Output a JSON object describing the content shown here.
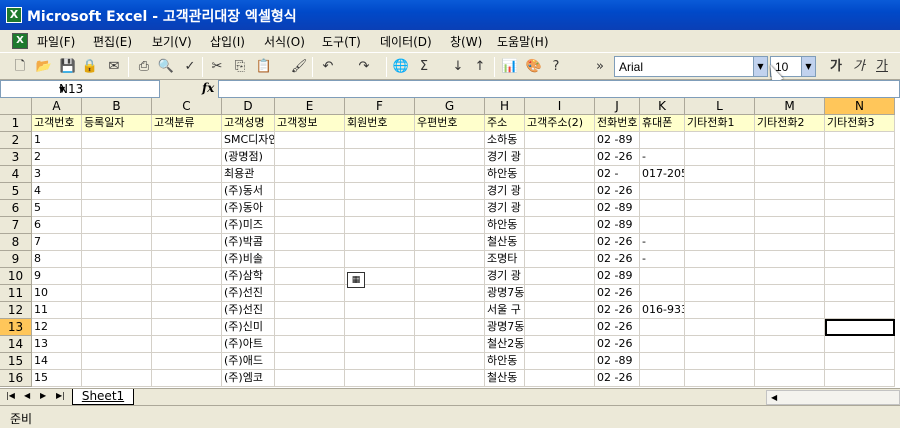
{
  "window": {
    "title": "Microsoft Excel - 고객관리대장 엑셀형식",
    "app_icon": "X"
  },
  "menu": [
    {
      "id": "file",
      "label": "파일(F)"
    },
    {
      "id": "edit",
      "label": "편집(E)"
    },
    {
      "id": "view",
      "label": "보기(V)"
    },
    {
      "id": "insert",
      "label": "삽입(I)"
    },
    {
      "id": "format",
      "label": "서식(O)"
    },
    {
      "id": "tools",
      "label": "도구(T)"
    },
    {
      "id": "data",
      "label": "데이터(D)"
    },
    {
      "id": "window",
      "label": "창(W)"
    },
    {
      "id": "help",
      "label": "도움말(H)"
    }
  ],
  "toolbar": {
    "font_name": "Arial",
    "font_size": "10",
    "bold_label": "가",
    "italic_label": "가",
    "underline_label": "가",
    "sigma": "Σ",
    "more": "»"
  },
  "formula_bar": {
    "name_box": "N13",
    "fx_label": "fx",
    "formula": ""
  },
  "columns": [
    "A",
    "B",
    "C",
    "D",
    "E",
    "F",
    "G",
    "H",
    "I",
    "J",
    "K",
    "L",
    "M",
    "N"
  ],
  "selected_column": "N",
  "header_row": [
    "고객번호",
    "등록일자",
    "고객분류",
    "고객성명",
    "고객정보",
    "회원번호",
    "우편번호",
    "주소",
    "고객주소(2)",
    "전화번호",
    "휴대폰",
    "기타전화1",
    "기타전화2",
    "기타전화3"
  ],
  "rows": [
    {
      "n": "1",
      "cells": [
        "고객번호",
        "등록일자",
        "고객분류",
        "고객성명",
        "고객정보",
        "회원번호",
        "우편번호",
        "주소",
        "고객주소(2)",
        "전화번호",
        "휴대폰",
        "기타전화1",
        "기타전화2",
        "기타전화3"
      ]
    },
    {
      "n": "2",
      "cells": [
        "1",
        "",
        "",
        "SMC디자인",
        "",
        "",
        "",
        "소하동",
        "",
        "02  -89",
        "",
        "",
        "",
        ""
      ]
    },
    {
      "n": "3",
      "cells": [
        "2",
        "",
        "",
        "(광명점)",
        "",
        "",
        "",
        "경기 광",
        "",
        "02  -26",
        "-",
        "",
        "",
        ""
      ]
    },
    {
      "n": "4",
      "cells": [
        "3",
        "",
        "",
        "최용관",
        "",
        "",
        "",
        "하안동",
        "",
        "02  -",
        "017-205",
        "",
        "",
        ""
      ]
    },
    {
      "n": "5",
      "cells": [
        "4",
        "",
        "",
        "(주)동서",
        "",
        "",
        "",
        "경기 광",
        "",
        "02  -26",
        "",
        "",
        "",
        ""
      ]
    },
    {
      "n": "6",
      "cells": [
        "5",
        "",
        "",
        "(주)동아",
        "",
        "",
        "",
        "경기 광",
        "",
        "02  -89",
        "",
        "",
        "",
        ""
      ]
    },
    {
      "n": "7",
      "cells": [
        "6",
        "",
        "",
        "(주)미즈",
        "",
        "",
        "",
        "하안동",
        "",
        "02  -89",
        "",
        "",
        "",
        ""
      ]
    },
    {
      "n": "8",
      "cells": [
        "7",
        "",
        "",
        "(주)박콤",
        "",
        "",
        "",
        "철산동",
        "",
        "02  -26",
        "-",
        "",
        "",
        ""
      ]
    },
    {
      "n": "9",
      "cells": [
        "8",
        "",
        "",
        "(주)비솔",
        "",
        "",
        "",
        "조명타",
        "",
        "02  -26",
        "-",
        "",
        "",
        ""
      ]
    },
    {
      "n": "10",
      "cells": [
        "9",
        "",
        "",
        "(주)삼학",
        "",
        "",
        "",
        "경기 광",
        "",
        "02  -89",
        "",
        "",
        "",
        ""
      ]
    },
    {
      "n": "11",
      "cells": [
        "10",
        "",
        "",
        "(주)선진",
        "",
        "",
        "",
        "광명7동",
        "",
        "02  -26",
        "",
        "",
        "",
        ""
      ]
    },
    {
      "n": "12",
      "cells": [
        "11",
        "",
        "",
        "(주)선진",
        "",
        "",
        "",
        "서울 구",
        "",
        "02  -26",
        "016-933",
        "",
        "",
        ""
      ]
    },
    {
      "n": "13",
      "cells": [
        "12",
        "",
        "",
        "(주)신미",
        "",
        "",
        "",
        "광명7동",
        "",
        "02  -26",
        "",
        "",
        "",
        ""
      ]
    },
    {
      "n": "14",
      "cells": [
        "13",
        "",
        "",
        "(주)아트",
        "",
        "",
        "",
        "철산2동",
        "",
        "02  -26",
        "",
        "",
        "",
        ""
      ]
    },
    {
      "n": "15",
      "cells": [
        "14",
        "",
        "",
        "(주)애드",
        "",
        "",
        "",
        "하안동",
        "",
        "02  -89",
        "",
        "",
        "",
        ""
      ]
    },
    {
      "n": "16",
      "cells": [
        "15",
        "",
        "",
        "(주)엠코",
        "",
        "",
        "",
        "철산동",
        "",
        "02  -26",
        "",
        "",
        "",
        ""
      ]
    }
  ],
  "active_cell": {
    "row": "13",
    "col": "N"
  },
  "sheet_tabs": [
    "Sheet1"
  ],
  "status": "준비"
}
